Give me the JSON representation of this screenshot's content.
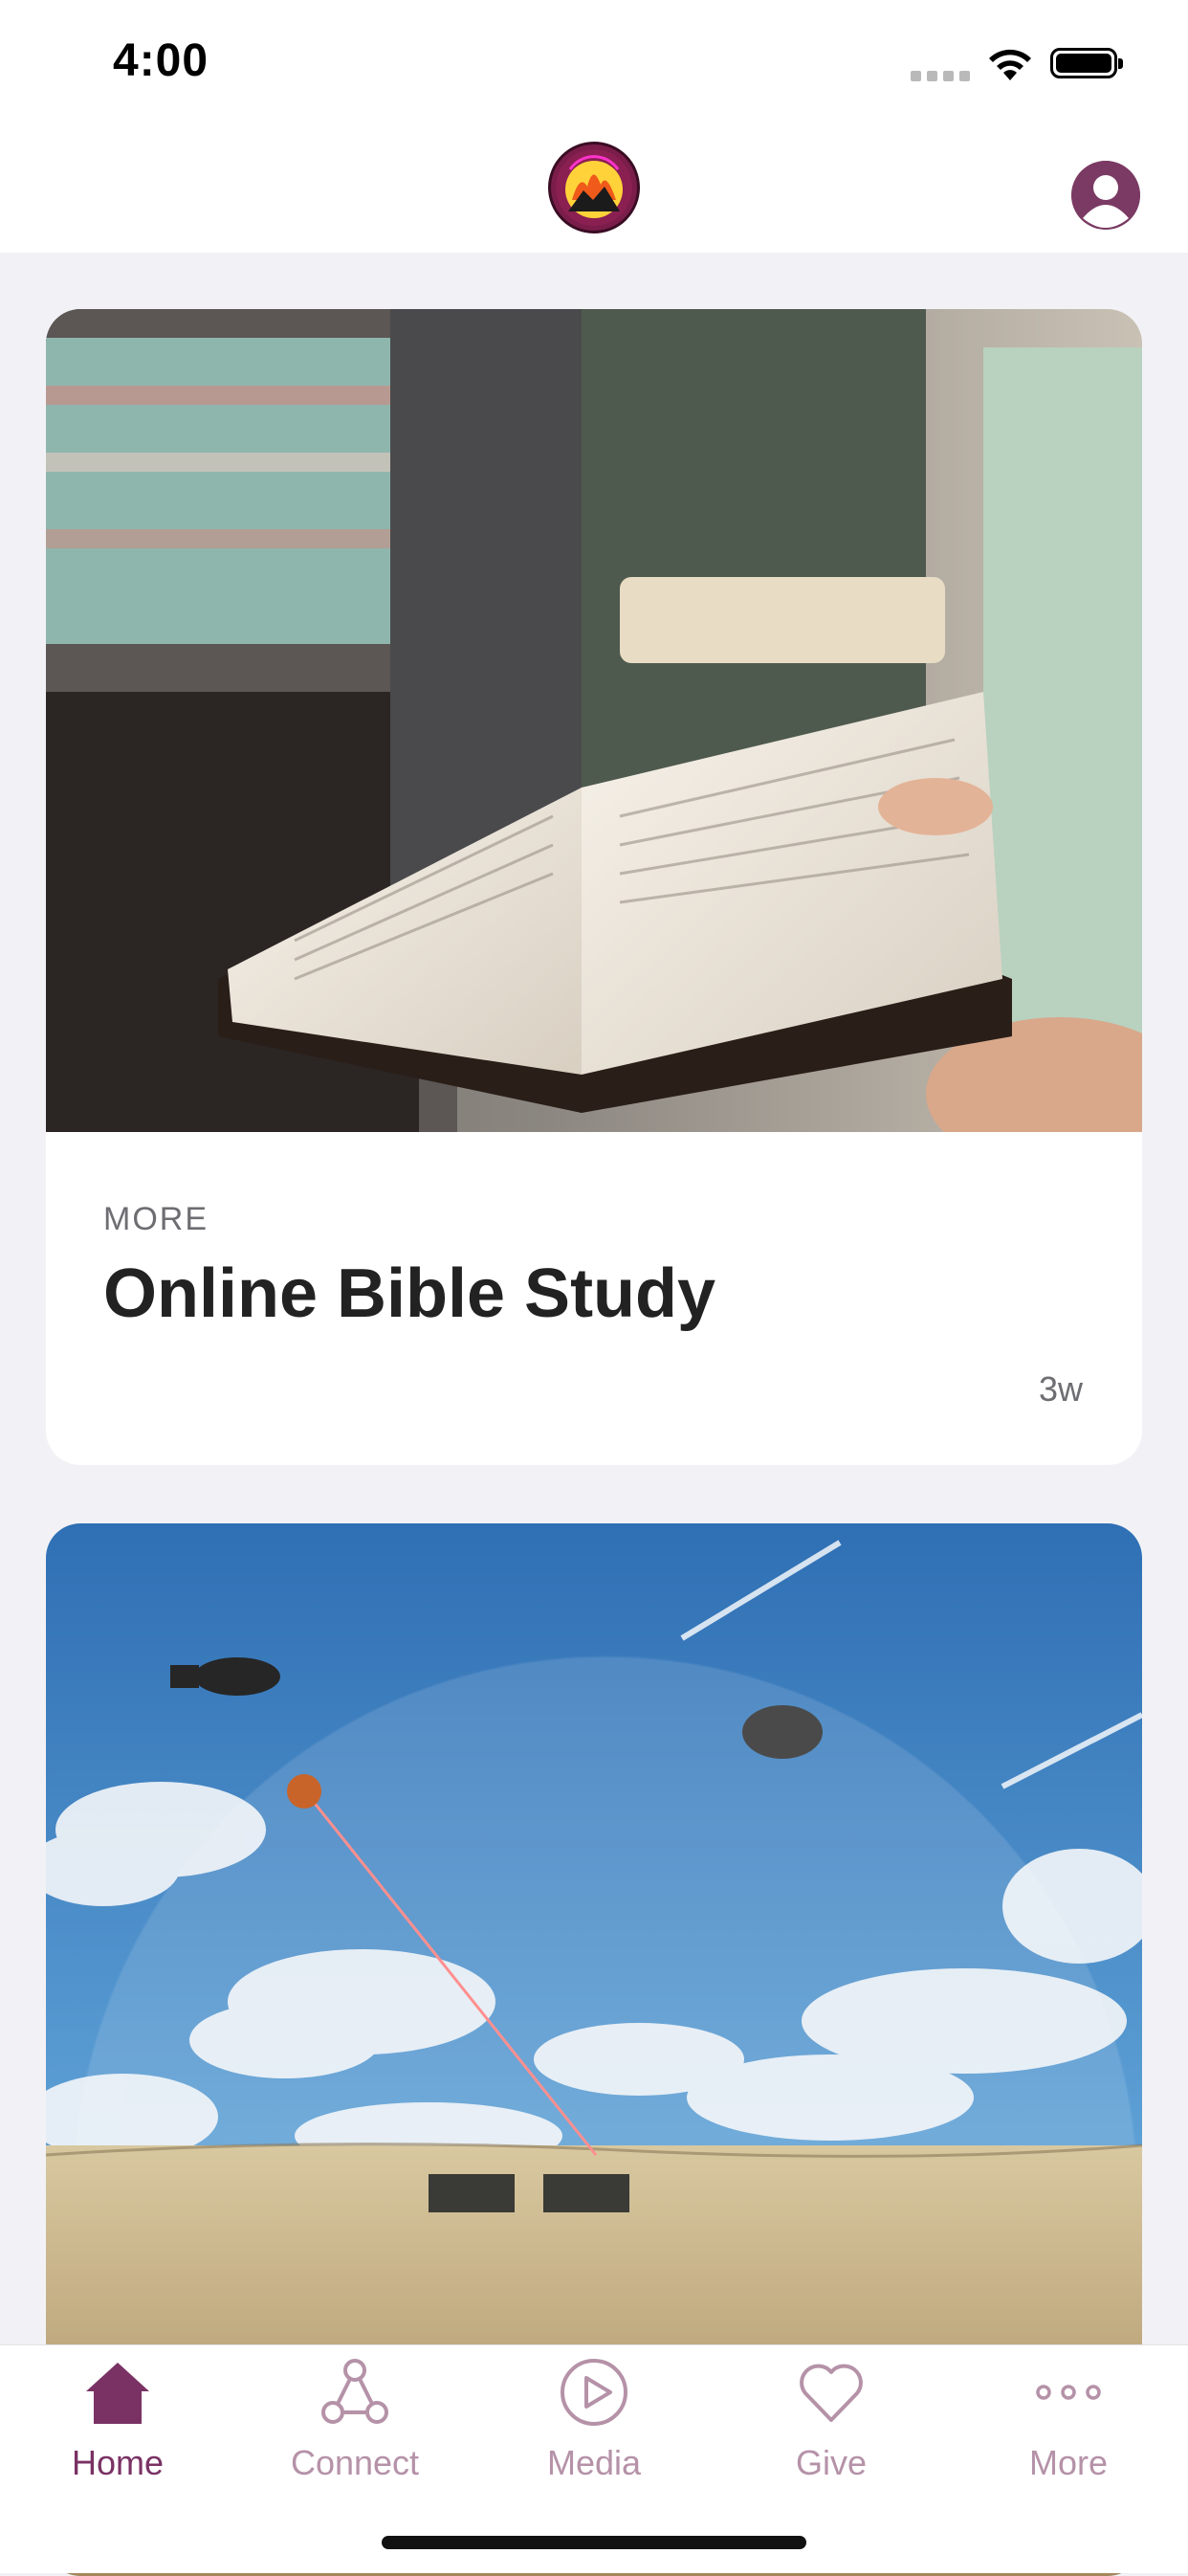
{
  "status_bar": {
    "time": "4:00"
  },
  "colors": {
    "accent": "#7a3264",
    "tab_inactive": "#b592a8",
    "background": "#f2f2f6"
  },
  "header": {
    "logo_icon": "church-logo-icon",
    "profile_icon": "user-profile-icon"
  },
  "feed": {
    "cards": [
      {
        "category": "MORE",
        "title": "Online Bible Study",
        "time": "3w",
        "image": "bible-study-photo"
      },
      {
        "image": "defense-dome-illustration"
      }
    ]
  },
  "tab_bar": {
    "tabs": [
      {
        "label": "Home",
        "icon": "home-icon",
        "active": true
      },
      {
        "label": "Connect",
        "icon": "connect-icon",
        "active": false
      },
      {
        "label": "Media",
        "icon": "play-icon",
        "active": false
      },
      {
        "label": "Give",
        "icon": "heart-icon",
        "active": false
      },
      {
        "label": "More",
        "icon": "more-dots-icon",
        "active": false
      }
    ]
  }
}
